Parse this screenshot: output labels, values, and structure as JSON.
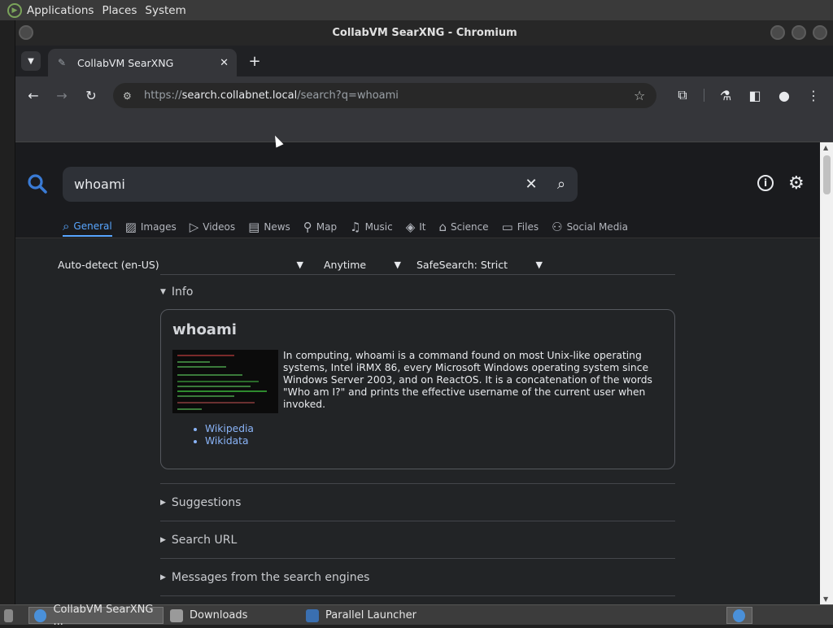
{
  "desktop": {
    "menus": [
      "Applications",
      "Places",
      "System"
    ]
  },
  "window": {
    "title": "CollabVM SearXNG - Chromium"
  },
  "browser": {
    "tab_title": "CollabVM SearXNG",
    "url_scheme": "https://",
    "url_host": "search.collabnet.local",
    "url_path": "/search?q=whoami"
  },
  "search": {
    "query": "whoami",
    "categories": [
      "General",
      "Images",
      "Videos",
      "News",
      "Map",
      "Music",
      "It",
      "Science",
      "Files",
      "Social Media"
    ],
    "active_category": "General",
    "language": "Auto-detect (en-US)",
    "time_range": "Anytime",
    "safesearch": "SafeSearch: Strict"
  },
  "infobox": {
    "section_label": "Info",
    "title": "whoami",
    "description": "In computing, whoami is a command found on most Unix-like operating systems, Intel iRMX 86, every Microsoft Windows operating system since Windows Server 2003, and on ReactOS. It is a concatenation of the words \"Who am I?\" and prints the effective username of the current user when invoked.",
    "links": [
      "Wikipedia",
      "Wikidata"
    ]
  },
  "sections": [
    "Suggestions",
    "Search URL",
    "Messages from the search engines"
  ],
  "taskbar": {
    "items": [
      "CollabVM SearXNG ...",
      "Downloads",
      "Parallel Launcher"
    ]
  },
  "colors": {
    "accent": "#58a6ff",
    "link": "#8ab4f8",
    "page_bg": "#222426"
  }
}
